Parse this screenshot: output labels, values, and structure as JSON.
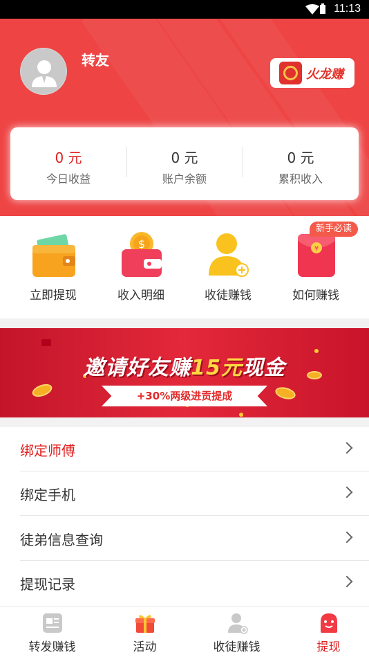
{
  "status_bar": {
    "time": "11:13",
    "wifi_icon": "wifi-icon",
    "battery_icon": "battery-icon"
  },
  "header": {
    "username": "转友",
    "brand_name": "火龙赚",
    "avatar_icon": "user-avatar-icon",
    "accent_color": "#ee4444"
  },
  "stats": [
    {
      "value": "0 元",
      "label": "今日收益",
      "highlight": true
    },
    {
      "value": "0 元",
      "label": "账户余额",
      "highlight": false
    },
    {
      "value": "0 元",
      "label": "累积收入",
      "highlight": false
    }
  ],
  "quick_actions": [
    {
      "label": "立即提现",
      "icon": "wallet-icon"
    },
    {
      "label": "收入明细",
      "icon": "coin-purse-icon"
    },
    {
      "label": "收徒赚钱",
      "icon": "add-user-icon"
    },
    {
      "label": "如何赚钱",
      "icon": "red-envelope-icon",
      "badge": "新手必读"
    }
  ],
  "banner": {
    "headline_pre": "邀请好友赚",
    "headline_num": "15元",
    "headline_post": "现金",
    "ribbon": "+30%两级进贡提成"
  },
  "menu": [
    {
      "label": "绑定师傅",
      "highlight": true
    },
    {
      "label": "绑定手机",
      "highlight": false
    },
    {
      "label": "徒弟信息查询",
      "highlight": false
    },
    {
      "label": "提现记录",
      "highlight": false
    }
  ],
  "tabbar": [
    {
      "label": "转发赚钱",
      "icon": "article-icon",
      "active": false
    },
    {
      "label": "活动",
      "icon": "gift-icon",
      "active": false
    },
    {
      "label": "收徒赚钱",
      "icon": "people-icon",
      "active": false
    },
    {
      "label": "提现",
      "icon": "smiley-wallet-icon",
      "active": true
    }
  ]
}
